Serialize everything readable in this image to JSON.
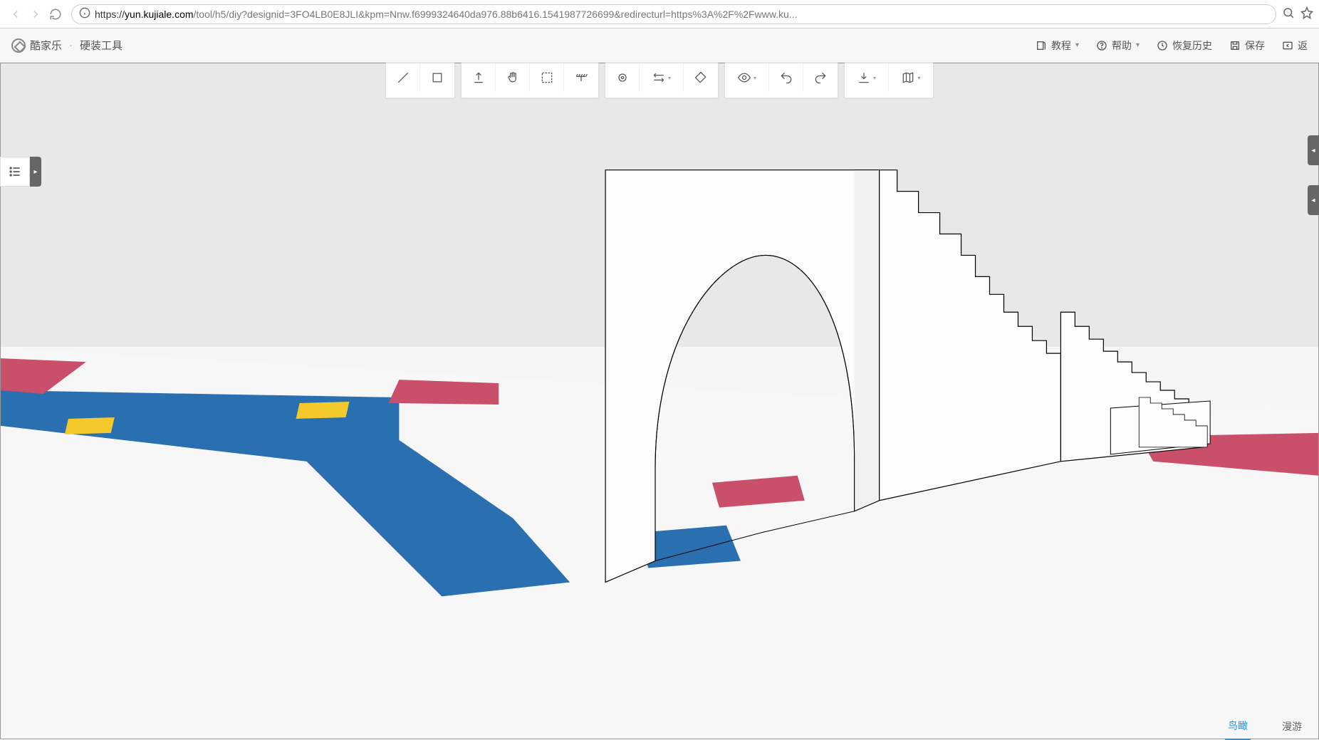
{
  "browser": {
    "url_prefix": "https://",
    "url_domain": "yun.kujiale.com",
    "url_path": "/tool/h5/diy?designid=3FO4LB0E8JLI&kpm=Nnw.f6999324640da976.88b6416.1541987726699&redirecturl=https%3A%2F%2Fwww.ku..."
  },
  "app": {
    "brand_name": "酷家乐",
    "tool_name": "硬装工具",
    "header": {
      "tutorial": "教程",
      "help": "帮助",
      "restore": "恢复历史",
      "save": "保存",
      "back": "返"
    }
  },
  "toolbar_groups": [
    {
      "id": "draw",
      "buttons": [
        {
          "name": "line-tool"
        },
        {
          "name": "rect-tool"
        }
      ]
    },
    {
      "id": "model",
      "buttons": [
        {
          "name": "extrude-tool"
        },
        {
          "name": "hand-tool"
        },
        {
          "name": "select-area-tool"
        },
        {
          "name": "ceiling-tool"
        }
      ]
    },
    {
      "id": "material",
      "buttons": [
        {
          "name": "target-tool"
        },
        {
          "name": "align-tool",
          "dropdown": true
        },
        {
          "name": "paint-tool"
        }
      ]
    },
    {
      "id": "view",
      "buttons": [
        {
          "name": "visibility-tool",
          "dropdown": true
        },
        {
          "name": "undo-tool"
        },
        {
          "name": "redo-tool"
        }
      ]
    },
    {
      "id": "export",
      "buttons": [
        {
          "name": "download-tool",
          "dropdown": true
        },
        {
          "name": "map-tool",
          "dropdown": true
        }
      ]
    }
  ],
  "view_tabs": {
    "birdseye": "鸟瞰",
    "roam": "漫游",
    "active": "birdseye"
  },
  "scene": {
    "colors": {
      "wall_fill": "#fcfcfc",
      "wall_stroke": "#000",
      "floor_blue": "#2a6fb0",
      "floor_red": "#c94f6a",
      "floor_yellow": "#f3c92b",
      "ground": "#f6f6f6"
    }
  }
}
